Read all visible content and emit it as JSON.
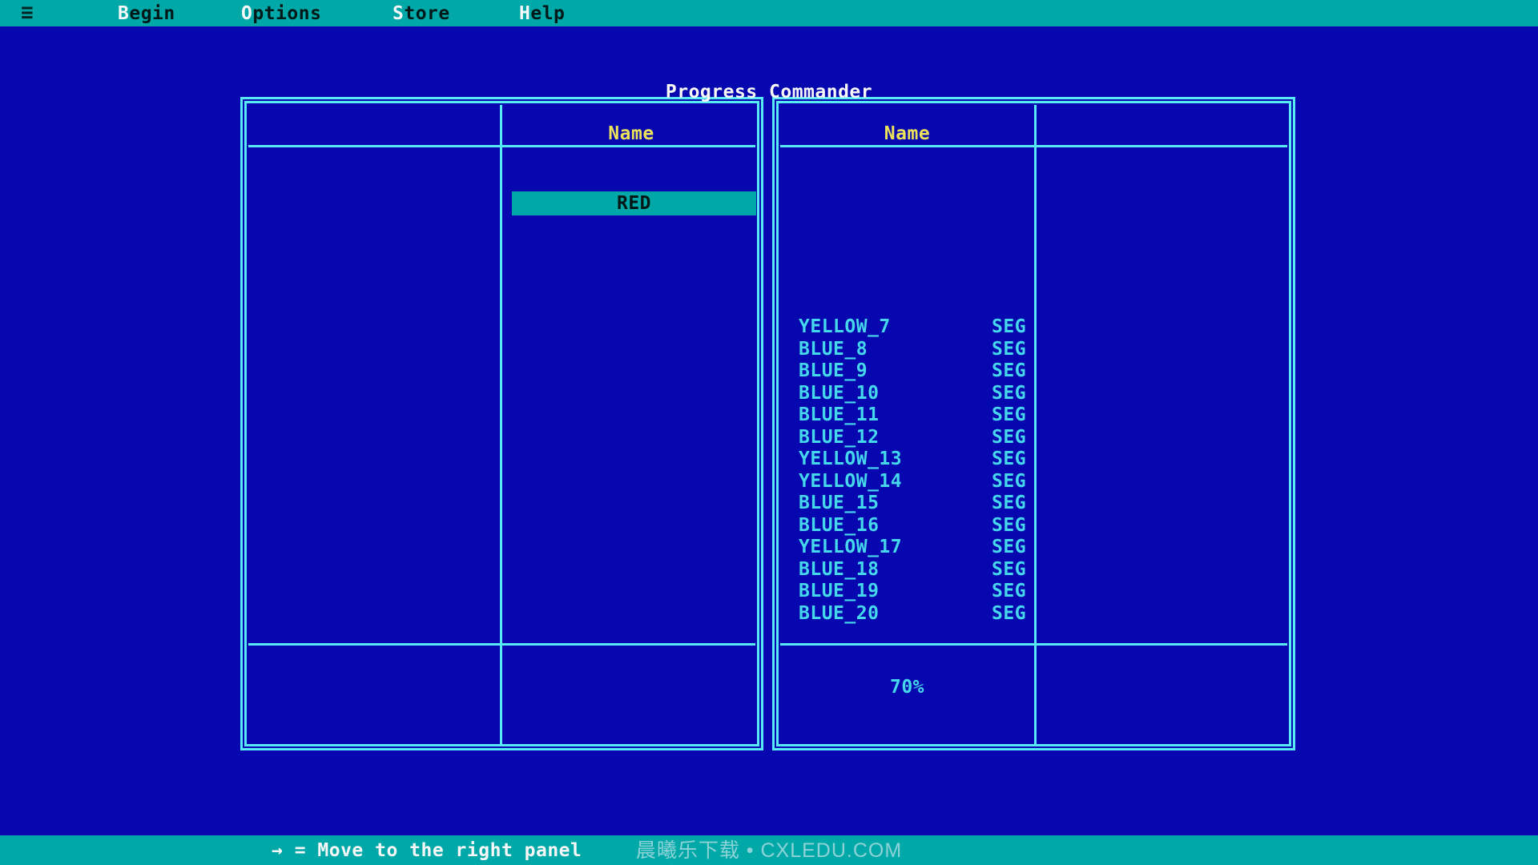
{
  "colors": {
    "background_blue": "#0707AF",
    "bar_teal": "#00A8A8",
    "border_cyan": "#57E9F5",
    "file_text_cyan": "#45D8EC",
    "header_yellow": "#EDE35A",
    "title_white": "#F8F8F8",
    "selection_teal": "#00A8A8"
  },
  "menu_bar": {
    "hamburger": "≡",
    "items": [
      {
        "hotkey": "B",
        "rest": "egin"
      },
      {
        "hotkey": "O",
        "rest": "ptions"
      },
      {
        "hotkey": "S",
        "rest": "tore"
      },
      {
        "hotkey": "H",
        "rest": "elp"
      }
    ]
  },
  "title": "Progress Commander",
  "left_panel": {
    "name_header": "Name",
    "selected_item": "RED"
  },
  "right_panel": {
    "name_header": "Name",
    "files": [
      {
        "name": "YELLOW_7",
        "ext": "SEG"
      },
      {
        "name": "BLUE_8",
        "ext": "SEG"
      },
      {
        "name": "BLUE_9",
        "ext": "SEG"
      },
      {
        "name": "BLUE_10",
        "ext": "SEG"
      },
      {
        "name": "BLUE_11",
        "ext": "SEG"
      },
      {
        "name": "BLUE_12",
        "ext": "SEG"
      },
      {
        "name": "YELLOW_13",
        "ext": "SEG"
      },
      {
        "name": "YELLOW_14",
        "ext": "SEG"
      },
      {
        "name": "BLUE_15",
        "ext": "SEG"
      },
      {
        "name": "BLUE_16",
        "ext": "SEG"
      },
      {
        "name": "YELLOW_17",
        "ext": "SEG"
      },
      {
        "name": "BLUE_18",
        "ext": "SEG"
      },
      {
        "name": "BLUE_19",
        "ext": "SEG"
      },
      {
        "name": "BLUE_20",
        "ext": "SEG"
      }
    ],
    "progress": "70%"
  },
  "status_bar": {
    "hint": "→ = Move to the right panel",
    "watermark": "晨曦乐下载 • CXLEDU.COM"
  }
}
